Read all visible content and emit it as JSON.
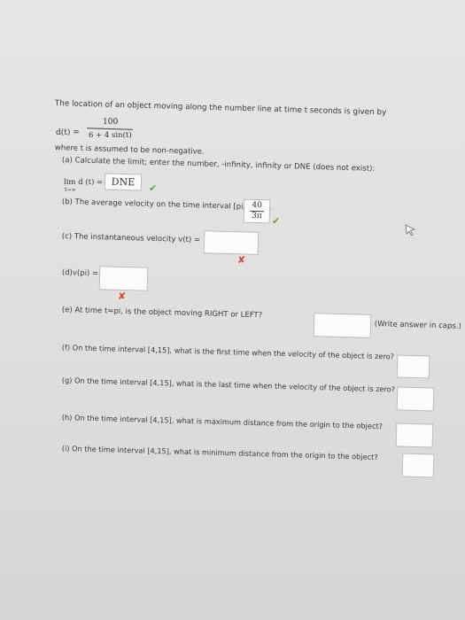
{
  "intro": "The location of an object moving along the number line at time t seconds is given by",
  "formula": {
    "lhs": "d(t) =",
    "numerator": "100",
    "denominator": "6 + 4 sin(t)"
  },
  "assumption": "where t is assumed to be non-negative.",
  "part_a": {
    "prompt": "(a) Calculate the limit; enter the number, -infinity, infinity or DNE (does not exist):",
    "limit_label": "lim d (t) =",
    "limit_sub": "t→∞",
    "answer": "DNE",
    "status": "correct"
  },
  "part_b": {
    "prompt": "(b) The average velocity on the time interval [pi/2,pi] is",
    "answer_num": "40",
    "answer_den": "3π",
    "status": "correct"
  },
  "part_c": {
    "prompt": "(c) The instantaneous velocity v(t) =",
    "answer": "",
    "status": "incorrect"
  },
  "part_d": {
    "prompt": "(d)v(pi) =",
    "answer": "",
    "status": "incorrect"
  },
  "part_e": {
    "prompt": "(e) At time t=pi, is the object moving RIGHT or LEFT?",
    "hint": "(Write answer in caps.)",
    "answer": ""
  },
  "part_f": {
    "prompt": "(f) On the time interval [4,15], what is the first time when the velocity of the object is zero?",
    "answer": ""
  },
  "part_g": {
    "prompt": "(g) On the time interval [4,15], what is the last time when the velocity of the object is zero?",
    "answer": ""
  },
  "part_h": {
    "prompt": "(h) On the time interval [4,15], what is maximum distance from the origin to the object?",
    "answer": ""
  },
  "part_i": {
    "prompt": "(i) On the time interval [4,15], what is minimum distance from the origin to the object?",
    "answer": ""
  },
  "icons": {
    "check": "check-icon",
    "cross": "cross-icon",
    "cursor": "mouse-pointer-icon"
  },
  "colors": {
    "correct": "#6aa335",
    "incorrect": "#d24a3c"
  }
}
